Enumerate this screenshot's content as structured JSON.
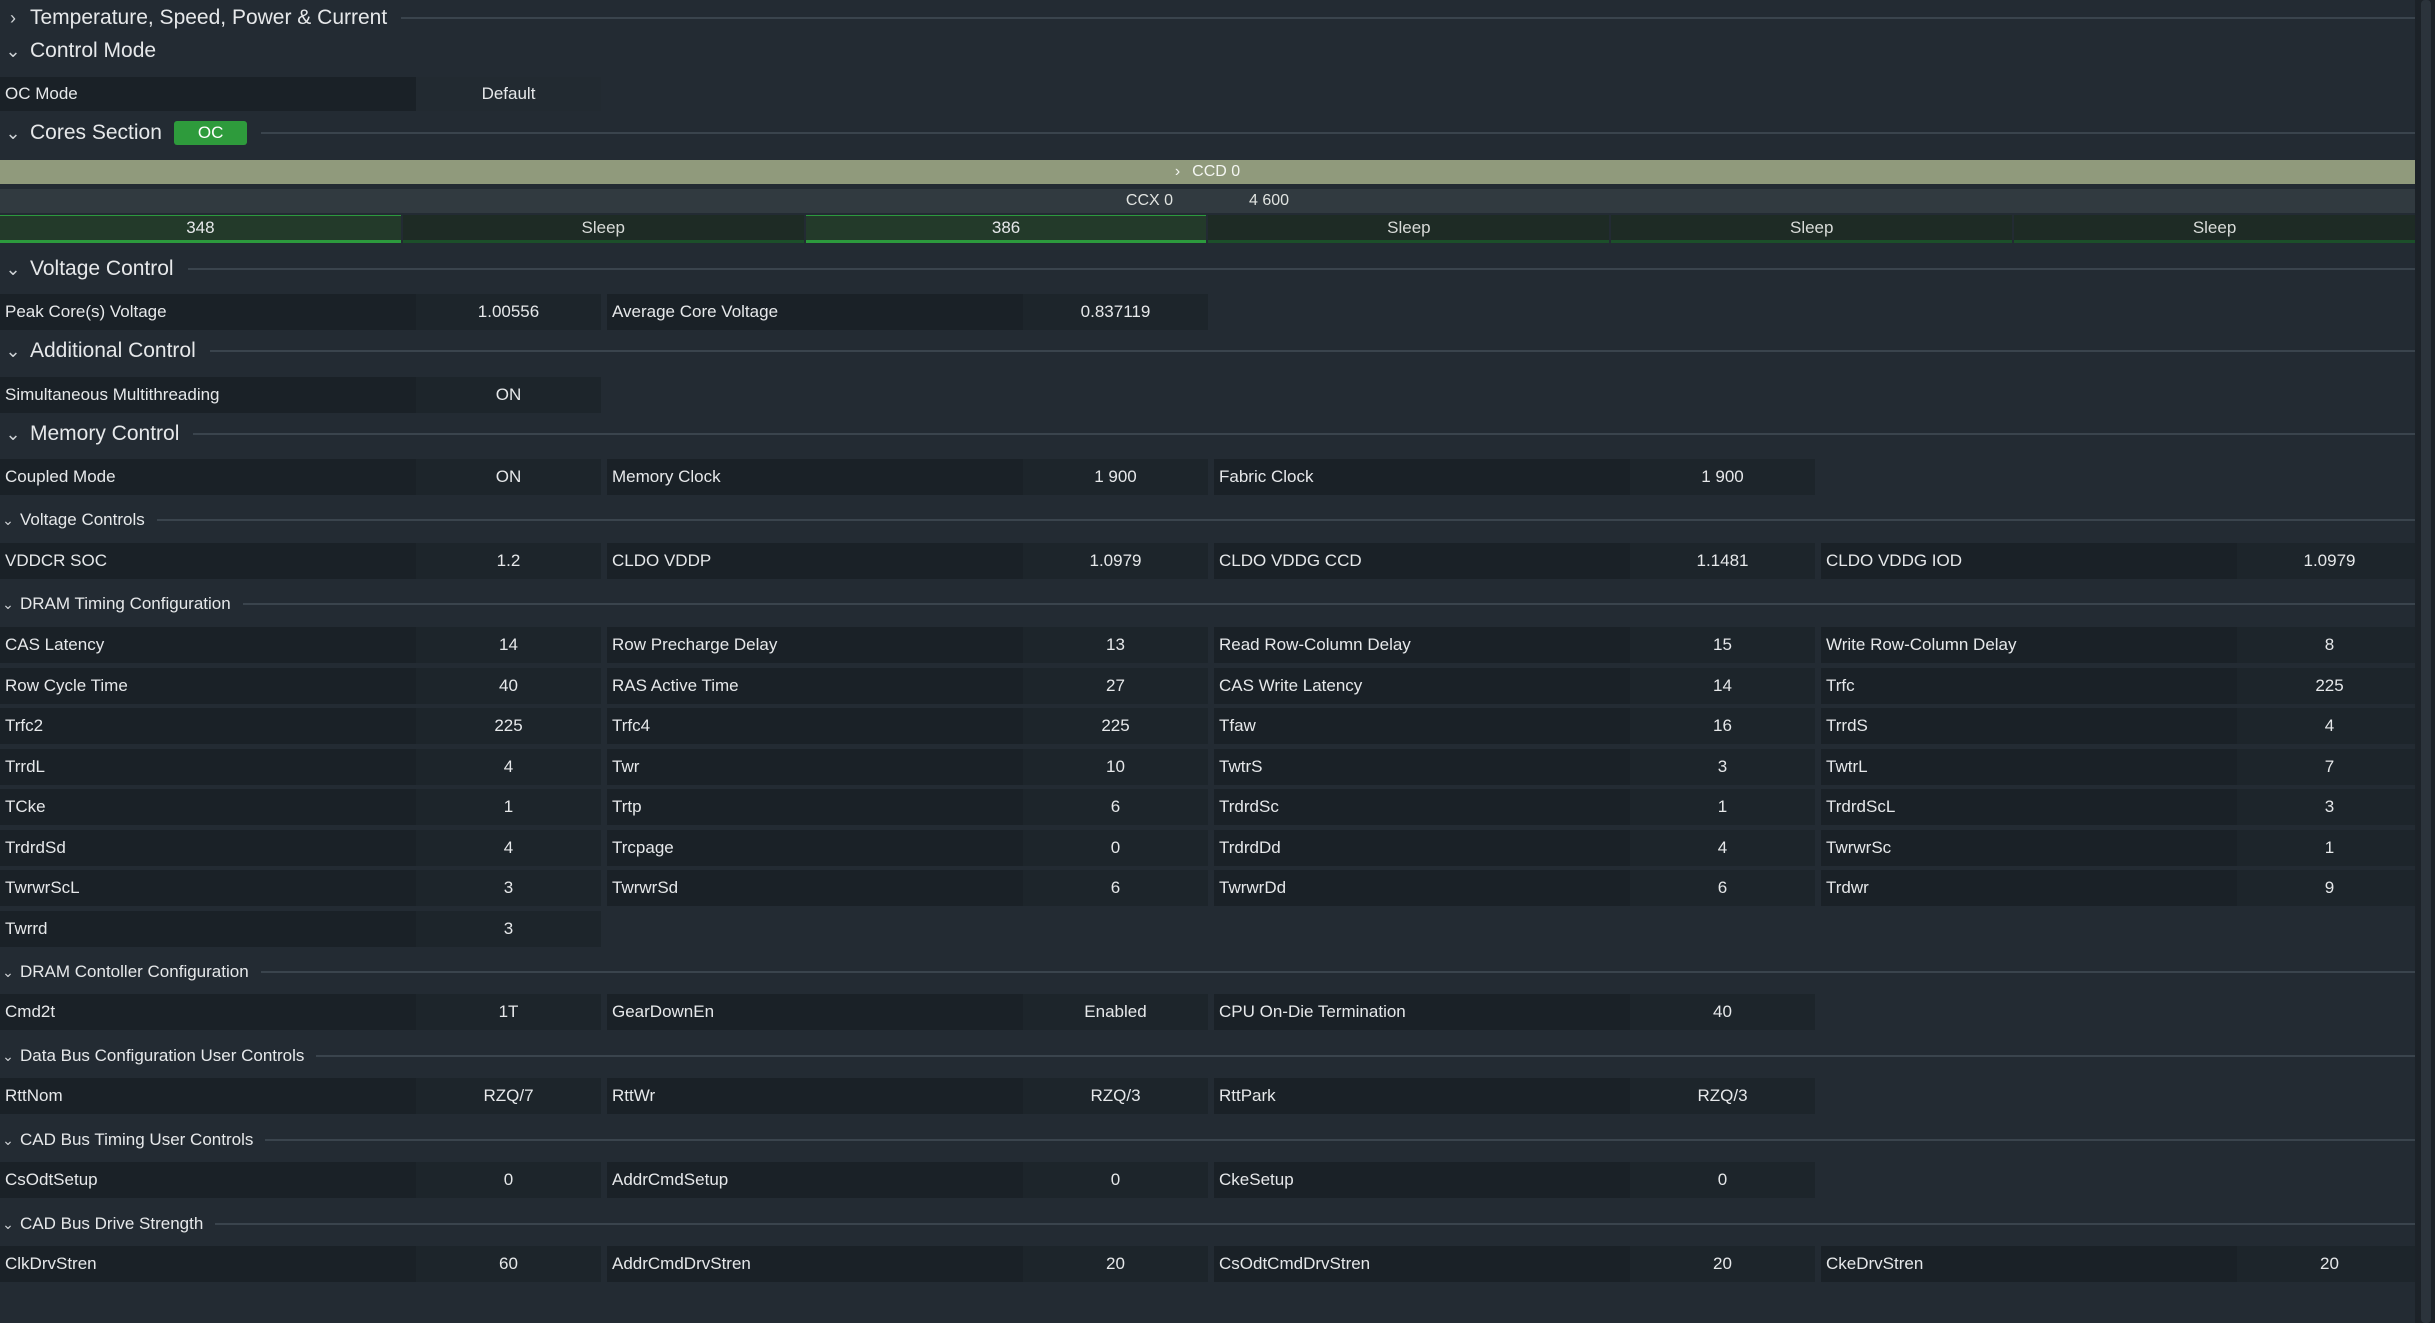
{
  "sections": {
    "temp": "Temperature, Speed, Power & Current",
    "control_mode": "Control Mode",
    "cores": "Cores Section",
    "cores_badge": "OC",
    "voltage_control": "Voltage Control",
    "additional_control": "Additional Control",
    "memory_control": "Memory Control",
    "voltage_controls": "Voltage Controls",
    "dram_timing": "DRAM Timing Configuration",
    "dram_controller": "DRAM Contoller Configuration",
    "data_bus": "Data Bus Configuration User Controls",
    "cad_timing": "CAD Bus Timing User Controls",
    "cad_drive": "CAD Bus Drive Strength"
  },
  "oc_mode": {
    "label": "OC Mode",
    "value": "Default"
  },
  "ccd": {
    "label": "CCD 0"
  },
  "ccx": {
    "label": "CCX 0",
    "value": "4 600"
  },
  "cores": [
    "348",
    "Sleep",
    "386",
    "Sleep",
    "Sleep",
    "Sleep"
  ],
  "voltage": [
    {
      "label": "Peak Core(s) Voltage",
      "value": "1.00556"
    },
    {
      "label": "Average Core Voltage",
      "value": "0.837119"
    }
  ],
  "additional": [
    {
      "label": "Simultaneous Multithreading",
      "value": "ON"
    }
  ],
  "memory": [
    {
      "label": "Coupled Mode",
      "value": "ON"
    },
    {
      "label": "Memory Clock",
      "value": "1 900"
    },
    {
      "label": "Fabric Clock",
      "value": "1 900"
    }
  ],
  "voltage_controls": [
    {
      "label": "VDDCR SOC",
      "value": "1.2"
    },
    {
      "label": "CLDO VDDP",
      "value": "1.0979"
    },
    {
      "label": "CLDO VDDG CCD",
      "value": "1.1481"
    },
    {
      "label": "CLDO VDDG IOD",
      "value": "1.0979"
    }
  ],
  "dram_timing": [
    [
      {
        "label": "CAS Latency",
        "value": "14"
      },
      {
        "label": "Row Precharge Delay",
        "value": "13"
      },
      {
        "label": "Read Row-Column Delay",
        "value": "15"
      },
      {
        "label": "Write Row-Column Delay",
        "value": "8"
      }
    ],
    [
      {
        "label": "Row Cycle Time",
        "value": "40"
      },
      {
        "label": "RAS Active Time",
        "value": "27"
      },
      {
        "label": "CAS Write Latency",
        "value": "14"
      },
      {
        "label": "Trfc",
        "value": "225"
      }
    ],
    [
      {
        "label": "Trfc2",
        "value": "225"
      },
      {
        "label": "Trfc4",
        "value": "225"
      },
      {
        "label": "Tfaw",
        "value": "16"
      },
      {
        "label": "TrrdS",
        "value": "4"
      }
    ],
    [
      {
        "label": "TrrdL",
        "value": "4"
      },
      {
        "label": "Twr",
        "value": "10"
      },
      {
        "label": "TwtrS",
        "value": "3"
      },
      {
        "label": "TwtrL",
        "value": "7"
      }
    ],
    [
      {
        "label": "TCke",
        "value": "1"
      },
      {
        "label": "Trtp",
        "value": "6"
      },
      {
        "label": "TrdrdSc",
        "value": "1"
      },
      {
        "label": "TrdrdScL",
        "value": "3"
      }
    ],
    [
      {
        "label": "TrdrdSd",
        "value": "4"
      },
      {
        "label": "Trcpage",
        "value": "0"
      },
      {
        "label": "TrdrdDd",
        "value": "4"
      },
      {
        "label": "TwrwrSc",
        "value": "1"
      }
    ],
    [
      {
        "label": "TwrwrScL",
        "value": "3"
      },
      {
        "label": "TwrwrSd",
        "value": "6"
      },
      {
        "label": "TwrwrDd",
        "value": "6"
      },
      {
        "label": "Trdwr",
        "value": "9"
      }
    ],
    [
      {
        "label": "Twrrd",
        "value": "3"
      }
    ]
  ],
  "dram_controller": [
    {
      "label": "Cmd2t",
      "value": "1T"
    },
    {
      "label": "GearDownEn",
      "value": "Enabled"
    },
    {
      "label": "CPU On-Die Termination",
      "value": "40"
    }
  ],
  "data_bus": [
    {
      "label": "RttNom",
      "value": "RZQ/7"
    },
    {
      "label": "RttWr",
      "value": "RZQ/3"
    },
    {
      "label": "RttPark",
      "value": "RZQ/3"
    }
  ],
  "cad_timing": [
    {
      "label": "CsOdtSetup",
      "value": "0"
    },
    {
      "label": "AddrCmdSetup",
      "value": "0"
    },
    {
      "label": "CkeSetup",
      "value": "0"
    }
  ],
  "cad_drive": [
    {
      "label": "ClkDrvStren",
      "value": "60"
    },
    {
      "label": "AddrCmdDrvStren",
      "value": "20"
    },
    {
      "label": "CsOdtCmdDrvStren",
      "value": "20"
    },
    {
      "label": "CkeDrvStren",
      "value": "20"
    }
  ]
}
